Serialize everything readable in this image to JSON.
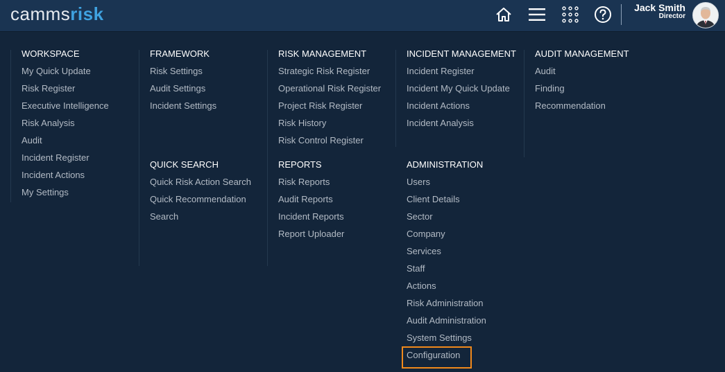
{
  "header": {
    "logo_part1": "camms",
    "logo_part2": "risk",
    "icons": [
      "home-icon",
      "menu-icon",
      "apps-grid-icon",
      "help-icon"
    ],
    "user_name": "Jack Smith",
    "user_role": "Director"
  },
  "menu": {
    "workspace": {
      "title": "WORKSPACE",
      "items": [
        "My Quick Update",
        "Risk Register",
        "Executive Intelligence",
        "Risk Analysis",
        "Audit",
        "Incident Register",
        "Incident Actions",
        "My Settings"
      ]
    },
    "framework": {
      "title": "FRAMEWORK",
      "items": [
        "Risk Settings",
        "Audit Settings",
        "Incident Settings"
      ]
    },
    "quick_search": {
      "title": "QUICK SEARCH",
      "items": [
        "Quick Risk Action Search",
        "Quick Recommendation",
        "Search"
      ]
    },
    "risk_management": {
      "title": "RISK MANAGEMENT",
      "items": [
        "Strategic Risk Register",
        "Operational Risk Register",
        "Project Risk Register",
        "Risk History",
        "Risk Control Register"
      ]
    },
    "reports": {
      "title": "REPORTS",
      "items": [
        "Risk Reports",
        "Audit Reports",
        "Incident Reports",
        "Report Uploader"
      ]
    },
    "incident_management": {
      "title": "INCIDENT MANAGEMENT",
      "items": [
        "Incident Register",
        "Incident My Quick Update",
        "Incident Actions",
        "Incident Analysis"
      ]
    },
    "administration": {
      "title": "ADMINISTRATION",
      "items": [
        "Users",
        "Client Details",
        "Sector",
        "Company",
        "Services",
        "Staff",
        "Actions",
        "Risk Administration",
        "Audit Administration",
        "System Settings",
        "Configuration"
      ]
    },
    "audit_management": {
      "title": "AUDIT MANAGEMENT",
      "items": [
        "Audit",
        "Finding",
        "Recommendation"
      ]
    }
  },
  "colors": {
    "background": "#13253a",
    "topbar": "#1a3452",
    "highlight": "#f1891b",
    "logo_accent": "#3fa2e0"
  }
}
